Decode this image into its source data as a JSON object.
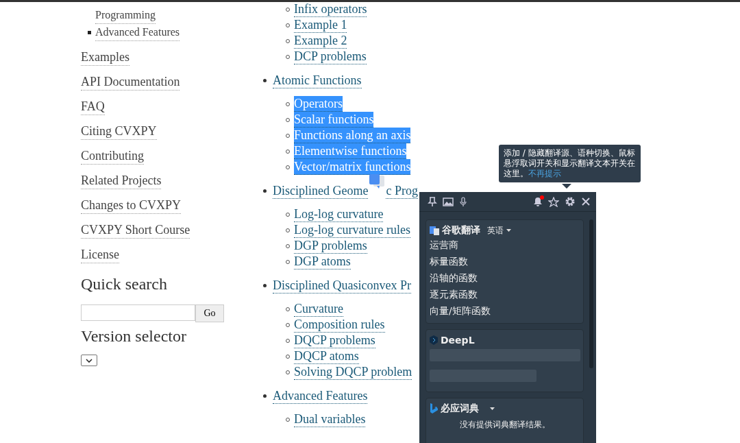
{
  "sidebar": {
    "items": [
      {
        "label": "Programming",
        "kind": "continuation"
      },
      {
        "label": "Advanced Features",
        "kind": "bullet"
      },
      {
        "label": "Examples",
        "kind": "link"
      },
      {
        "label": "API Documentation",
        "kind": "link"
      },
      {
        "label": "FAQ",
        "kind": "link"
      },
      {
        "label": "Citing CVXPY",
        "kind": "link"
      },
      {
        "label": "Contributing",
        "kind": "link"
      },
      {
        "label": "Related Projects",
        "kind": "link"
      },
      {
        "label": "Changes to CVXPY",
        "kind": "link"
      },
      {
        "label": "CVXPY Short Course",
        "kind": "link"
      },
      {
        "label": "License",
        "kind": "link"
      }
    ],
    "quick_search": {
      "title": "Quick search",
      "button": "Go"
    },
    "version_selector": {
      "title": "Version selector"
    }
  },
  "toc": [
    {
      "children": [
        {
          "label": "Infix operators",
          "selected": false
        },
        {
          "label": "Example 1",
          "selected": false
        },
        {
          "label": "Example 2",
          "selected": false
        },
        {
          "label": "DCP problems",
          "selected": false
        }
      ]
    },
    {
      "label": "Atomic Functions",
      "children": [
        {
          "label": "Operators",
          "selected": true
        },
        {
          "label": "Scalar functions",
          "selected": true
        },
        {
          "label": "Functions along an axis",
          "selected": true
        },
        {
          "label": "Elementwise functions",
          "selected": true
        },
        {
          "label": "Vector/matrix functions",
          "selected": true
        }
      ]
    },
    {
      "label_parts": [
        "Disciplined Geome",
        "c Prog"
      ],
      "children": [
        {
          "label": "Log-log curvature",
          "selected": false
        },
        {
          "label": "Log-log curvature rules",
          "selected": false
        },
        {
          "label": "DGP problems",
          "selected": false
        },
        {
          "label": "DGP atoms",
          "selected": false
        }
      ]
    },
    {
      "label": "Disciplined Quasiconvex Pr",
      "children": [
        {
          "label": "Curvature",
          "selected": false
        },
        {
          "label": "Composition rules",
          "selected": false
        },
        {
          "label": "DQCP problems",
          "selected": false
        },
        {
          "label": "DQCP atoms",
          "selected": false
        },
        {
          "label": "Solving DQCP problem",
          "selected": false
        }
      ]
    },
    {
      "label": "Advanced Features",
      "children": [
        {
          "label": "Dual variables",
          "selected": false
        }
      ]
    }
  ],
  "tooltip": {
    "text": "添加 / 隐藏翻译源、语种切换、鼠标悬浮取词开关和显示翻译文本开关在这里。",
    "link": "不再提示"
  },
  "translator": {
    "bell_badge": true,
    "sections": [
      {
        "kind": "google",
        "title": "谷歌翻译",
        "language": "英语",
        "lines": [
          "运营商",
          "标量函数",
          "沿轴的函数",
          "逐元素函数",
          "向量/矩阵函数"
        ]
      },
      {
        "kind": "deepl",
        "title": "DeepL"
      },
      {
        "kind": "bing",
        "title": "必应词典",
        "message": "没有提供词典翻译结果。"
      }
    ]
  }
}
